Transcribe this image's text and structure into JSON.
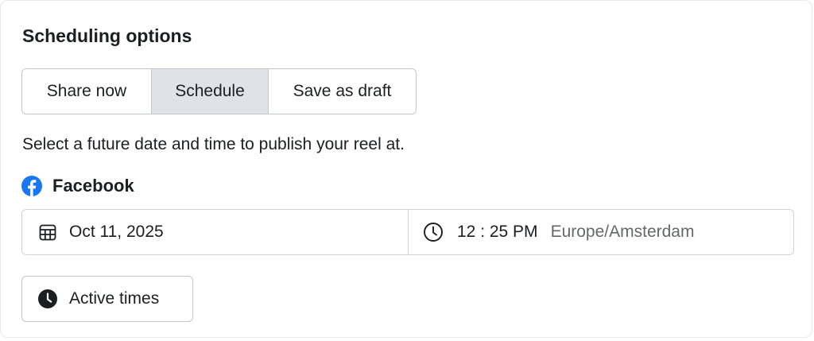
{
  "scheduling": {
    "title": "Scheduling options",
    "options": [
      {
        "label": "Share now",
        "selected": false
      },
      {
        "label": "Schedule",
        "selected": true
      },
      {
        "label": "Save as draft",
        "selected": false
      }
    ],
    "helper_text": "Select a future date and time to publish your reel at.",
    "platform": {
      "name": "Facebook",
      "icon": "facebook-icon",
      "brand_color": "#1877f2"
    },
    "date": {
      "icon": "calendar-icon",
      "value": "Oct 11, 2025"
    },
    "time": {
      "icon": "clock-icon",
      "value": "12 : 25 PM",
      "timezone": "Europe/Amsterdam"
    },
    "active_times": {
      "icon": "clock-filled-icon",
      "label": "Active times"
    }
  },
  "colors": {
    "selected_segment_bg": "#dfe3e8",
    "border": "#c3c7cc",
    "text": "#1c1e21",
    "secondary_text": "#65676b"
  }
}
